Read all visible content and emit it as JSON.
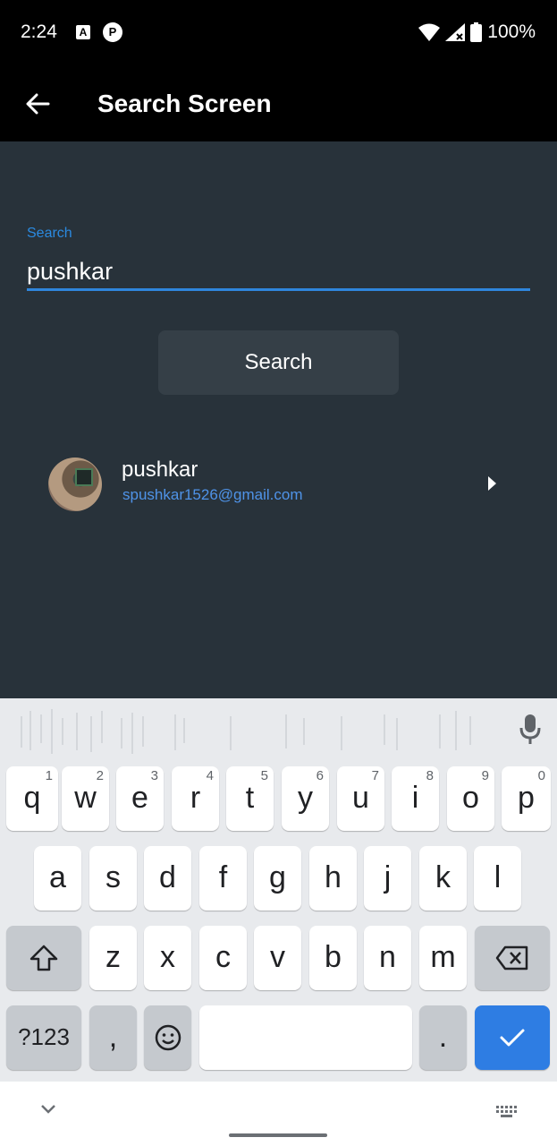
{
  "status_bar": {
    "time": "2:24",
    "notification_icons": [
      "a-app-icon",
      "p-app-icon"
    ],
    "battery": "100%",
    "icons": [
      "wifi-icon",
      "signal-icon",
      "battery-icon"
    ]
  },
  "app_bar": {
    "title": "Search Screen",
    "back_icon": "arrow-back-icon"
  },
  "search": {
    "label": "Search",
    "value": "pushkar",
    "button_label": "Search",
    "accent_color": "#2f86dc"
  },
  "results": [
    {
      "name": "pushkar",
      "email": "spushkar1526@gmail.com"
    }
  ],
  "keyboard": {
    "row1": [
      {
        "k": "q",
        "h": "1"
      },
      {
        "k": "w",
        "h": "2"
      },
      {
        "k": "e",
        "h": "3"
      },
      {
        "k": "r",
        "h": "4"
      },
      {
        "k": "t",
        "h": "5"
      },
      {
        "k": "y",
        "h": "6"
      },
      {
        "k": "u",
        "h": "7"
      },
      {
        "k": "i",
        "h": "8"
      },
      {
        "k": "o",
        "h": "9"
      },
      {
        "k": "p",
        "h": "0"
      }
    ],
    "row2": [
      "a",
      "s",
      "d",
      "f",
      "g",
      "h",
      "j",
      "k",
      "l"
    ],
    "row3": [
      "z",
      "x",
      "c",
      "v",
      "b",
      "n",
      "m"
    ],
    "symbols_label": "?123",
    "comma": ",",
    "period": ".",
    "enter_color": "#2e7de3"
  },
  "nav_bar": {
    "icons": [
      "chevron-down-icon",
      "keyboard-icon"
    ]
  }
}
